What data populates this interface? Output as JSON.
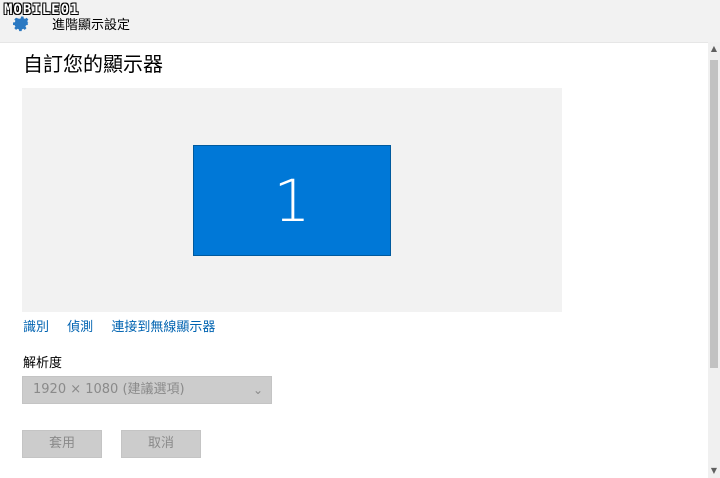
{
  "watermark": "MOBILE01",
  "window": {
    "title": "進階顯示設定"
  },
  "page": {
    "title": "自訂您的顯示器"
  },
  "display": {
    "monitor_number": "1"
  },
  "links": [
    {
      "label": "識別"
    },
    {
      "label": "偵測"
    },
    {
      "label": "連接到無線顯示器"
    }
  ],
  "resolution": {
    "label": "解析度",
    "selected": "1920 × 1080 (建議選項)"
  },
  "buttons": {
    "apply": "套用",
    "cancel": "取消"
  },
  "colors": {
    "accent": "#0078d7",
    "link": "#0063b1",
    "disabled": "#cccccc"
  },
  "icons": {
    "app": "gear-icon",
    "dropdown": "chevron-down-icon"
  }
}
